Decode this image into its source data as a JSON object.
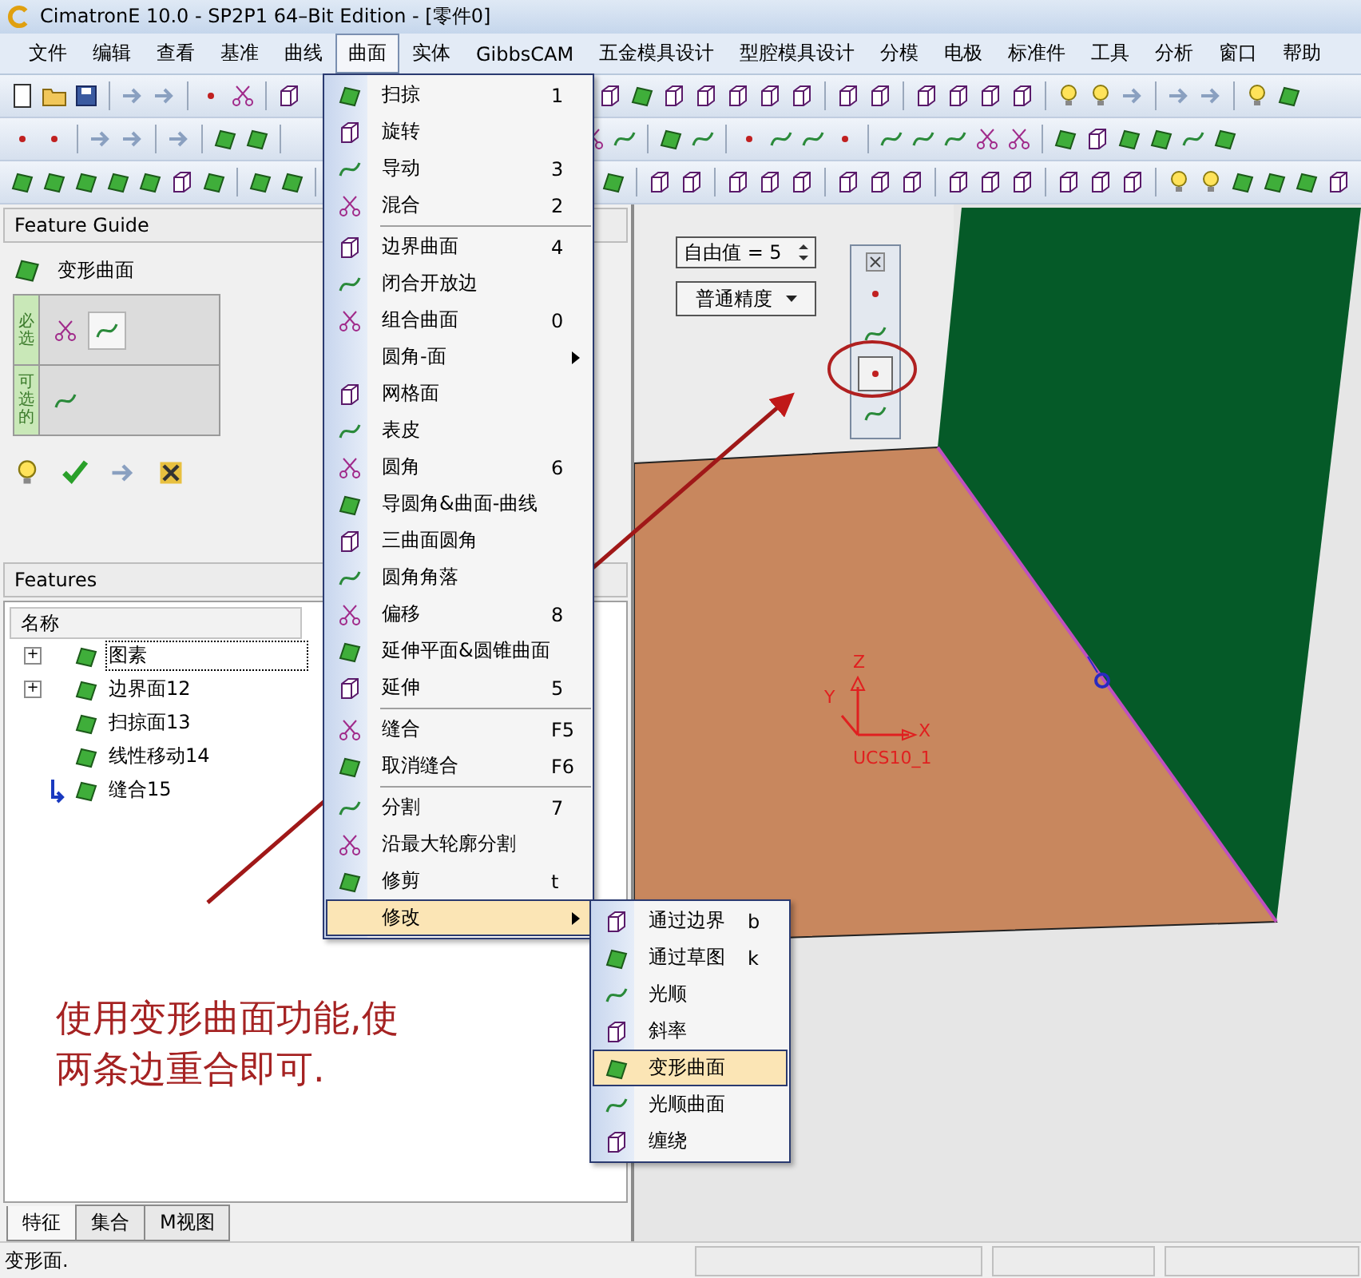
{
  "window": {
    "title": "CimatronE 10.0 - SP2P1 64–Bit Edition - [零件0]"
  },
  "menu_bar": [
    {
      "label": "文件",
      "selected": false
    },
    {
      "label": "编辑",
      "selected": false
    },
    {
      "label": "查看",
      "selected": false
    },
    {
      "label": "基准",
      "selected": false
    },
    {
      "label": "曲线",
      "selected": false
    },
    {
      "label": "曲面",
      "selected": true
    },
    {
      "label": "实体",
      "selected": false
    },
    {
      "label": "GibbsCAM",
      "selected": false
    },
    {
      "label": "五金模具设计",
      "selected": false
    },
    {
      "label": "型腔模具设计",
      "selected": false
    },
    {
      "label": "分模",
      "selected": false
    },
    {
      "label": "电极",
      "selected": false
    },
    {
      "label": "标准件",
      "selected": false
    },
    {
      "label": "工具",
      "selected": false
    },
    {
      "label": "分析",
      "selected": false
    },
    {
      "label": "窗口",
      "selected": false
    },
    {
      "label": "帮助",
      "selected": false
    }
  ],
  "surface_menu": {
    "items": [
      {
        "kind": "item",
        "label": "扫掠",
        "shortcut": "1",
        "has_icon": true,
        "submenu": false,
        "selected": false
      },
      {
        "kind": "item",
        "label": "旋转",
        "has_icon": true,
        "submenu": false,
        "selected": false
      },
      {
        "kind": "item",
        "label": "导动",
        "shortcut": "3",
        "has_icon": true,
        "submenu": false,
        "selected": false
      },
      {
        "kind": "item",
        "label": "混合",
        "shortcut": "2",
        "has_icon": true,
        "submenu": false,
        "selected": false
      },
      {
        "kind": "separator"
      },
      {
        "kind": "item",
        "label": "边界曲面",
        "shortcut": "4",
        "has_icon": true,
        "submenu": false,
        "selected": false
      },
      {
        "kind": "item",
        "label": "闭合开放边",
        "has_icon": true,
        "submenu": false,
        "selected": false
      },
      {
        "kind": "item",
        "label": "组合曲面",
        "shortcut": "0",
        "has_icon": true,
        "submenu": false,
        "selected": false
      },
      {
        "kind": "item",
        "label": "圆角-面",
        "has_icon": false,
        "submenu": true,
        "selected": false
      },
      {
        "kind": "item",
        "label": "网格面",
        "has_icon": true,
        "submenu": false,
        "selected": false
      },
      {
        "kind": "item",
        "label": "表皮",
        "has_icon": true,
        "submenu": false,
        "selected": false
      },
      {
        "kind": "item",
        "label": "圆角",
        "shortcut": "6",
        "has_icon": true,
        "submenu": false,
        "selected": false
      },
      {
        "kind": "item",
        "label": "导圆角&曲面-曲线",
        "has_icon": true,
        "submenu": false,
        "selected": false
      },
      {
        "kind": "item",
        "label": "三曲面圆角",
        "has_icon": true,
        "submenu": false,
        "selected": false
      },
      {
        "kind": "item",
        "label": "圆角角落",
        "has_icon": true,
        "submenu": false,
        "selected": false
      },
      {
        "kind": "item",
        "label": "偏移",
        "shortcut": "8",
        "has_icon": true,
        "submenu": false,
        "selected": false
      },
      {
        "kind": "item",
        "label": "延伸平面&圆锥曲面",
        "has_icon": true,
        "submenu": false,
        "selected": false
      },
      {
        "kind": "item",
        "label": "延伸",
        "shortcut": "5",
        "has_icon": true,
        "submenu": false,
        "selected": false
      },
      {
        "kind": "separator"
      },
      {
        "kind": "item",
        "label": "缝合",
        "shortcut": "F5",
        "has_icon": true,
        "submenu": false,
        "selected": false
      },
      {
        "kind": "item",
        "label": "取消缝合",
        "shortcut": "F6",
        "has_icon": true,
        "submenu": false,
        "selected": false
      },
      {
        "kind": "separator"
      },
      {
        "kind": "item",
        "label": "分割",
        "shortcut": "7",
        "has_icon": true,
        "submenu": false,
        "selected": false
      },
      {
        "kind": "item",
        "label": "沿最大轮廓分割",
        "has_icon": true,
        "submenu": false,
        "selected": false
      },
      {
        "kind": "item",
        "label": "修剪",
        "shortcut": "t",
        "has_icon": true,
        "submenu": false,
        "selected": false
      },
      {
        "kind": "item",
        "label": "修改",
        "has_icon": false,
        "submenu": true,
        "selected": true
      }
    ]
  },
  "modify_submenu": {
    "items": [
      {
        "label": "通过边界",
        "shortcut": "b",
        "selected": false
      },
      {
        "label": "通过草图",
        "shortcut": "k",
        "selected": false
      },
      {
        "label": "光顺",
        "selected": false
      },
      {
        "label": "斜率",
        "selected": false
      },
      {
        "label": "变形曲面",
        "selected": true
      },
      {
        "label": "光顺曲面",
        "selected": false
      },
      {
        "label": "缠绕",
        "selected": false
      }
    ]
  },
  "feature_guide": {
    "title": "Feature Guide",
    "operation": "变形曲面",
    "groups": [
      {
        "label": "必选"
      },
      {
        "label": "可选的"
      }
    ]
  },
  "features": {
    "title": "Features",
    "column": "名称",
    "tree": [
      {
        "label": "图素",
        "toggle": "+",
        "focused": true,
        "current": false
      },
      {
        "label": "边界面12",
        "toggle": "+",
        "focused": false,
        "current": false
      },
      {
        "label": "扫掠面13",
        "focused": false,
        "current": false
      },
      {
        "label": "线性移动14",
        "focused": false,
        "current": false
      },
      {
        "label": "缝合15",
        "focused": false,
        "current": true
      }
    ]
  },
  "panel_tabs": [
    {
      "label": "特征",
      "selected": true
    },
    {
      "label": "集合",
      "selected": false
    },
    {
      "label": "M视图",
      "selected": false
    }
  ],
  "viewport": {
    "free_value": "自由值 = 5",
    "precision": "普通精度",
    "mini_toolbar": [
      {
        "selected": false
      },
      {
        "selected": false
      },
      {
        "selected": true
      },
      {
        "selected": false
      }
    ],
    "ucs": {
      "name": "UCS10_1",
      "x": "X",
      "y": "Y",
      "z": "Z"
    }
  },
  "annotation": {
    "lines": [
      "使用变形曲面功能,使",
      "两条边重合即可."
    ]
  },
  "status_bar": {
    "message": "变形面."
  }
}
